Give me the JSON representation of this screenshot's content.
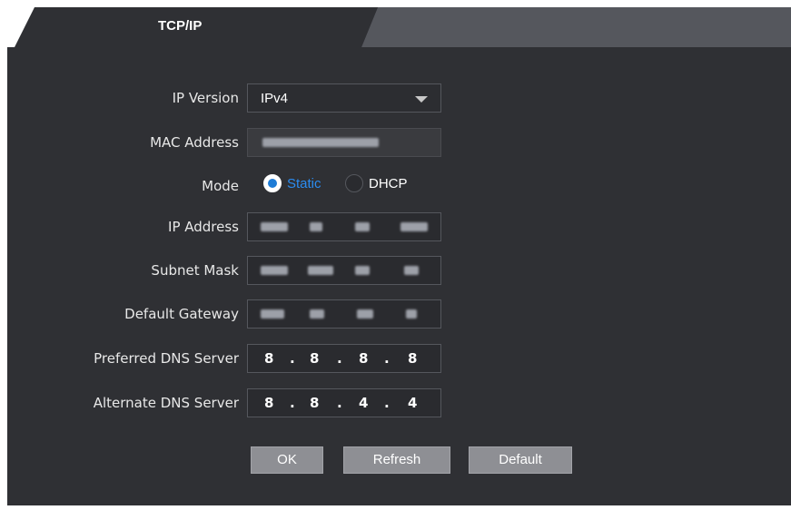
{
  "tab": {
    "label": "TCP/IP"
  },
  "form": {
    "ip_version": {
      "label": "IP Version",
      "value": "IPv4"
    },
    "mac_address": {
      "label": "MAC Address"
    },
    "mode": {
      "label": "Mode",
      "options": [
        {
          "label": "Static",
          "selected": true
        },
        {
          "label": "DHCP",
          "selected": false
        }
      ]
    },
    "ip_address": {
      "label": "IP Address"
    },
    "subnet_mask": {
      "label": "Subnet Mask"
    },
    "default_gateway": {
      "label": "Default Gateway"
    },
    "preferred_dns": {
      "label": "Preferred DNS Server",
      "octets": [
        "8",
        "8",
        "8",
        "8"
      ]
    },
    "alternate_dns": {
      "label": "Alternate DNS Server",
      "octets": [
        "8",
        "8",
        "4",
        "4"
      ]
    }
  },
  "buttons": {
    "ok": "OK",
    "refresh": "Refresh",
    "default": "Default"
  },
  "colors": {
    "panel": "#2f3034",
    "accent": "#1e7cd6",
    "button": "#8e8f94"
  }
}
